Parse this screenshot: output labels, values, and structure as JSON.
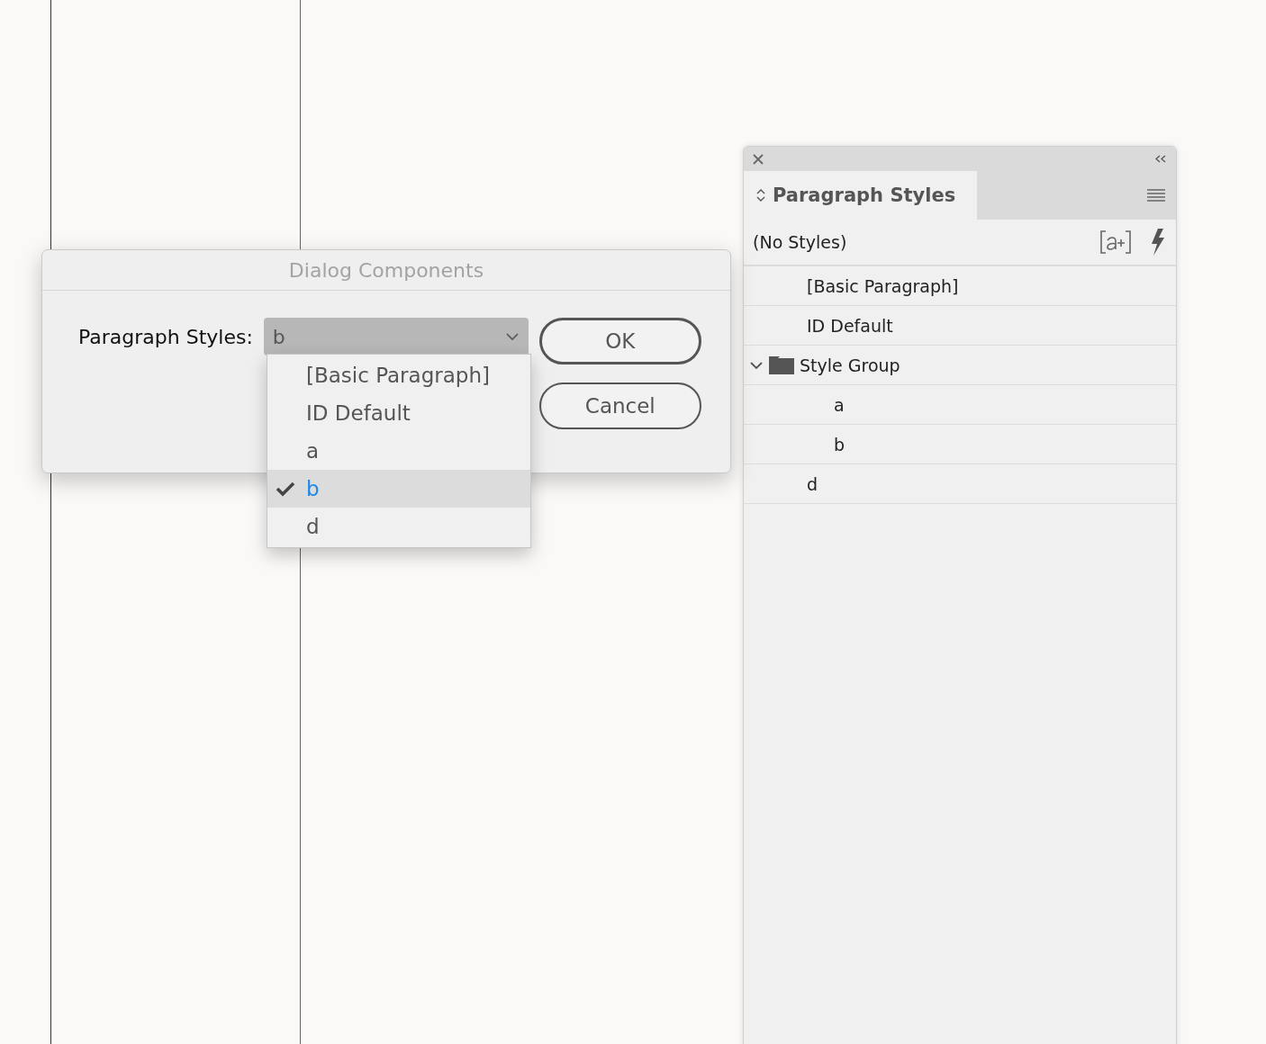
{
  "dialog": {
    "title": "Dialog Components",
    "field_label": "Paragraph Styles:",
    "dropdown": {
      "value": "b",
      "expanded": true,
      "options": [
        {
          "label": "[Basic Paragraph]",
          "selected": false
        },
        {
          "label": "ID Default",
          "selected": false
        },
        {
          "label": "a",
          "selected": false
        },
        {
          "label": "b",
          "selected": true
        },
        {
          "label": "d",
          "selected": false
        }
      ]
    },
    "buttons": [
      {
        "label": "OK",
        "default": true
      },
      {
        "label": "Cancel",
        "default": false
      }
    ]
  },
  "panel": {
    "tab": "Paragraph Styles",
    "current_style": "(No Styles)",
    "styles": [
      {
        "label": "[Basic Paragraph]",
        "kind": "style"
      },
      {
        "label": "ID Default",
        "kind": "style"
      },
      {
        "label": "Style Group",
        "kind": "group",
        "expanded": true,
        "children": [
          {
            "label": "a",
            "kind": "style"
          },
          {
            "label": "b",
            "kind": "style"
          }
        ]
      },
      {
        "label": "d",
        "kind": "style"
      }
    ]
  }
}
